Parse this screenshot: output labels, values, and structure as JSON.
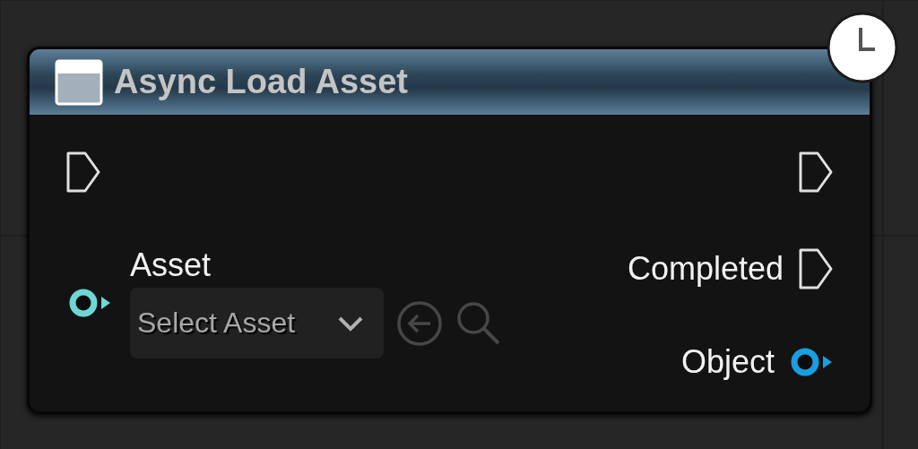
{
  "node": {
    "title": "Async Load Asset",
    "inputs": [
      {
        "kind": "exec"
      },
      {
        "kind": "object",
        "label": "Asset",
        "color": "#6fd6d6",
        "dropdown": {
          "value": "Select Asset"
        }
      }
    ],
    "outputs": [
      {
        "kind": "exec"
      },
      {
        "kind": "exec",
        "label": "Completed"
      },
      {
        "kind": "object",
        "label": "Object",
        "color": "#1a9ee0"
      }
    ]
  }
}
